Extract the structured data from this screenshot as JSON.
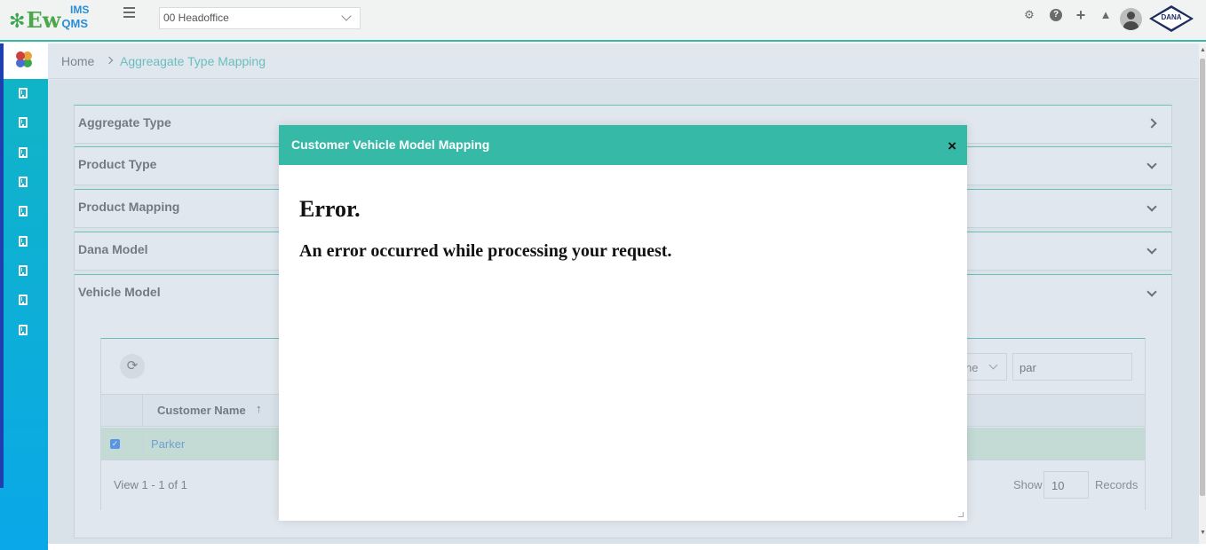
{
  "header": {
    "logo_ew": "Ew",
    "logo_ims": "IMS",
    "logo_qms": "QMS",
    "branch_select_value": "00 Headoffice",
    "brand_logo_text": "DANA"
  },
  "breadcrumb": {
    "home": "Home",
    "current": "Aggreagate Type Mapping"
  },
  "accordions": [
    {
      "title": "Aggregate Type",
      "state": "collapsed"
    },
    {
      "title": "Product Type",
      "state": "expandable"
    },
    {
      "title": "Product Mapping",
      "state": "expandable"
    },
    {
      "title": "Dana Model",
      "state": "expandable"
    },
    {
      "title": "Vehicle Model",
      "state": "expanded"
    }
  ],
  "grid": {
    "filter_select_partial": "ne",
    "search_value": "par",
    "column_header": "Customer Name",
    "sort_indicator": "↑",
    "rows": [
      {
        "customer_name": "Parker",
        "selected": true
      }
    ],
    "view_count": "View 1 - 1 of 1",
    "show_label": "Show",
    "page_size": "10",
    "records_label": "Records"
  },
  "modal": {
    "title": "Customer Vehicle Model Mapping",
    "close_symbol": "×",
    "error_heading": "Error.",
    "error_message": "An error occurred while processing your request."
  },
  "colors": {
    "accent": "#37b9a8",
    "sidebar_top": "#11b5c4",
    "sidebar_bottom": "#0aa8e8",
    "row_selected": "#cfead4",
    "link": "#3a87c8"
  },
  "icons": [
    "hamburger-icon",
    "gear-icon",
    "help-icon",
    "plus-icon",
    "bell-icon",
    "user-avatar",
    "building-icon",
    "refresh-icon",
    "close-icon",
    "chevron-down-icon",
    "chevron-right-icon"
  ]
}
